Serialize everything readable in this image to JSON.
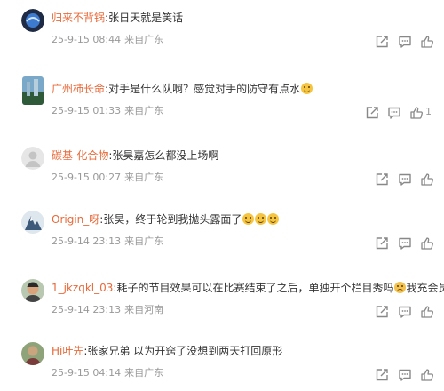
{
  "comments": [
    {
      "username": "归来不背锅",
      "separator": ":",
      "text": "张日天就是笑话",
      "emojis": [],
      "time": "25-9-15 08:44",
      "location": "来自广东",
      "actions": [
        "share-icon",
        "comment-icon",
        "like-icon"
      ]
    },
    {
      "username": "广州柿长命",
      "separator": ":",
      "text": "对手是什么队啊？感觉对手的防守有点水",
      "emojis": [
        "emoji-smile"
      ],
      "time": "25-9-15 01:33",
      "location": "来自广东",
      "actions": [
        "share-icon",
        "comment-icon",
        "like-icon"
      ],
      "like_count": "1"
    },
    {
      "username": "碳基-化合物",
      "separator": ":",
      "text": "张昊嘉怎么都没上场啊",
      "emojis": [],
      "time": "25-9-15 00:27",
      "location": "来自广东",
      "actions": [
        "share-icon",
        "comment-icon",
        "like-icon"
      ]
    },
    {
      "username": "Origin_呀",
      "separator": ":",
      "text": "张昊，终于轮到我抛头露面了",
      "emojis": [
        "emoji-smile",
        "emoji-smile",
        "emoji-smile"
      ],
      "time": "25-9-14 23:13",
      "location": "来自广东",
      "actions": [
        "share-icon",
        "comment-icon",
        "like-icon"
      ]
    },
    {
      "username": "1_jkzqkl_03",
      "separator": ":",
      "text": "耗子的节目效果可以在比赛结束了之后，单独开个栏目秀吗",
      "text_after_emoji": "我充会员",
      "emojis": [
        "emoji-cry"
      ],
      "time": "25-9-14 23:13",
      "location": "来自河南",
      "actions": [
        "share-icon",
        "comment-icon",
        "like-icon"
      ]
    },
    {
      "username": "Hi叶先",
      "separator": ":",
      "text": "张家兄弟 以为开窍了没想到两天打回原形",
      "emojis": [],
      "time": "25-9-15 04:14",
      "location": "来自广东",
      "actions": [
        "share-icon",
        "comment-icon",
        "like-icon"
      ]
    }
  ],
  "colors": {
    "username": "#e86a3a",
    "meta": "#999999",
    "icon": "#888888",
    "text": "#333333"
  }
}
